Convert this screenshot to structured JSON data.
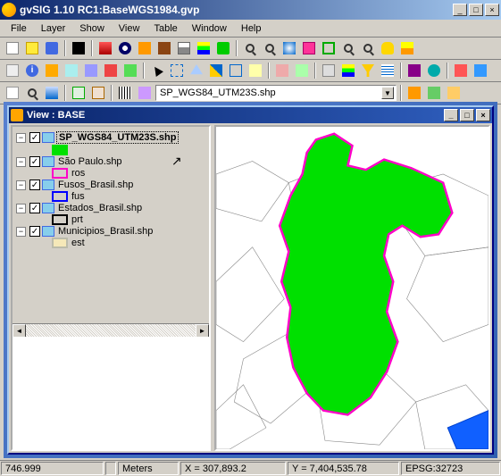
{
  "title": "gvSIG 1.10 RC1:BaseWGS1984.gvp",
  "menu": [
    "File",
    "Layer",
    "Show",
    "View",
    "Table",
    "Window",
    "Help"
  ],
  "row3_label": "SP_WGS84_UTM23S.shp",
  "view_window": {
    "title": "View : BASE"
  },
  "layers": [
    {
      "name": "SP_WGS84_UTM23S.shp",
      "selected": true,
      "legend": "",
      "symFill": "#00e000",
      "symBorder": "#00e000"
    },
    {
      "name": "São Paulo.shp",
      "selected": false,
      "legend": "ros",
      "symFill": "transparent",
      "symBorder": "#ff00c8"
    },
    {
      "name": "Fusos_Brasil.shp",
      "selected": false,
      "legend": "fus",
      "symFill": "transparent",
      "symBorder": "#0000ff"
    },
    {
      "name": "Estados_Brasil.shp",
      "selected": false,
      "legend": "prt",
      "symFill": "transparent",
      "symBorder": "#000000"
    },
    {
      "name": "Municipios_Brasil.shp",
      "selected": false,
      "legend": "est",
      "symFill": "#f5e8b8",
      "symBorder": "#bba"
    }
  ],
  "status": {
    "scale": "746.999",
    "unitsLabel": "",
    "units": "Meters",
    "x": "X = 307,893.2",
    "y": "Y = 7,404,535.78",
    "epsg": "EPSG:32723"
  },
  "winbtns": {
    "min": "_",
    "max": "□",
    "close": "×"
  }
}
